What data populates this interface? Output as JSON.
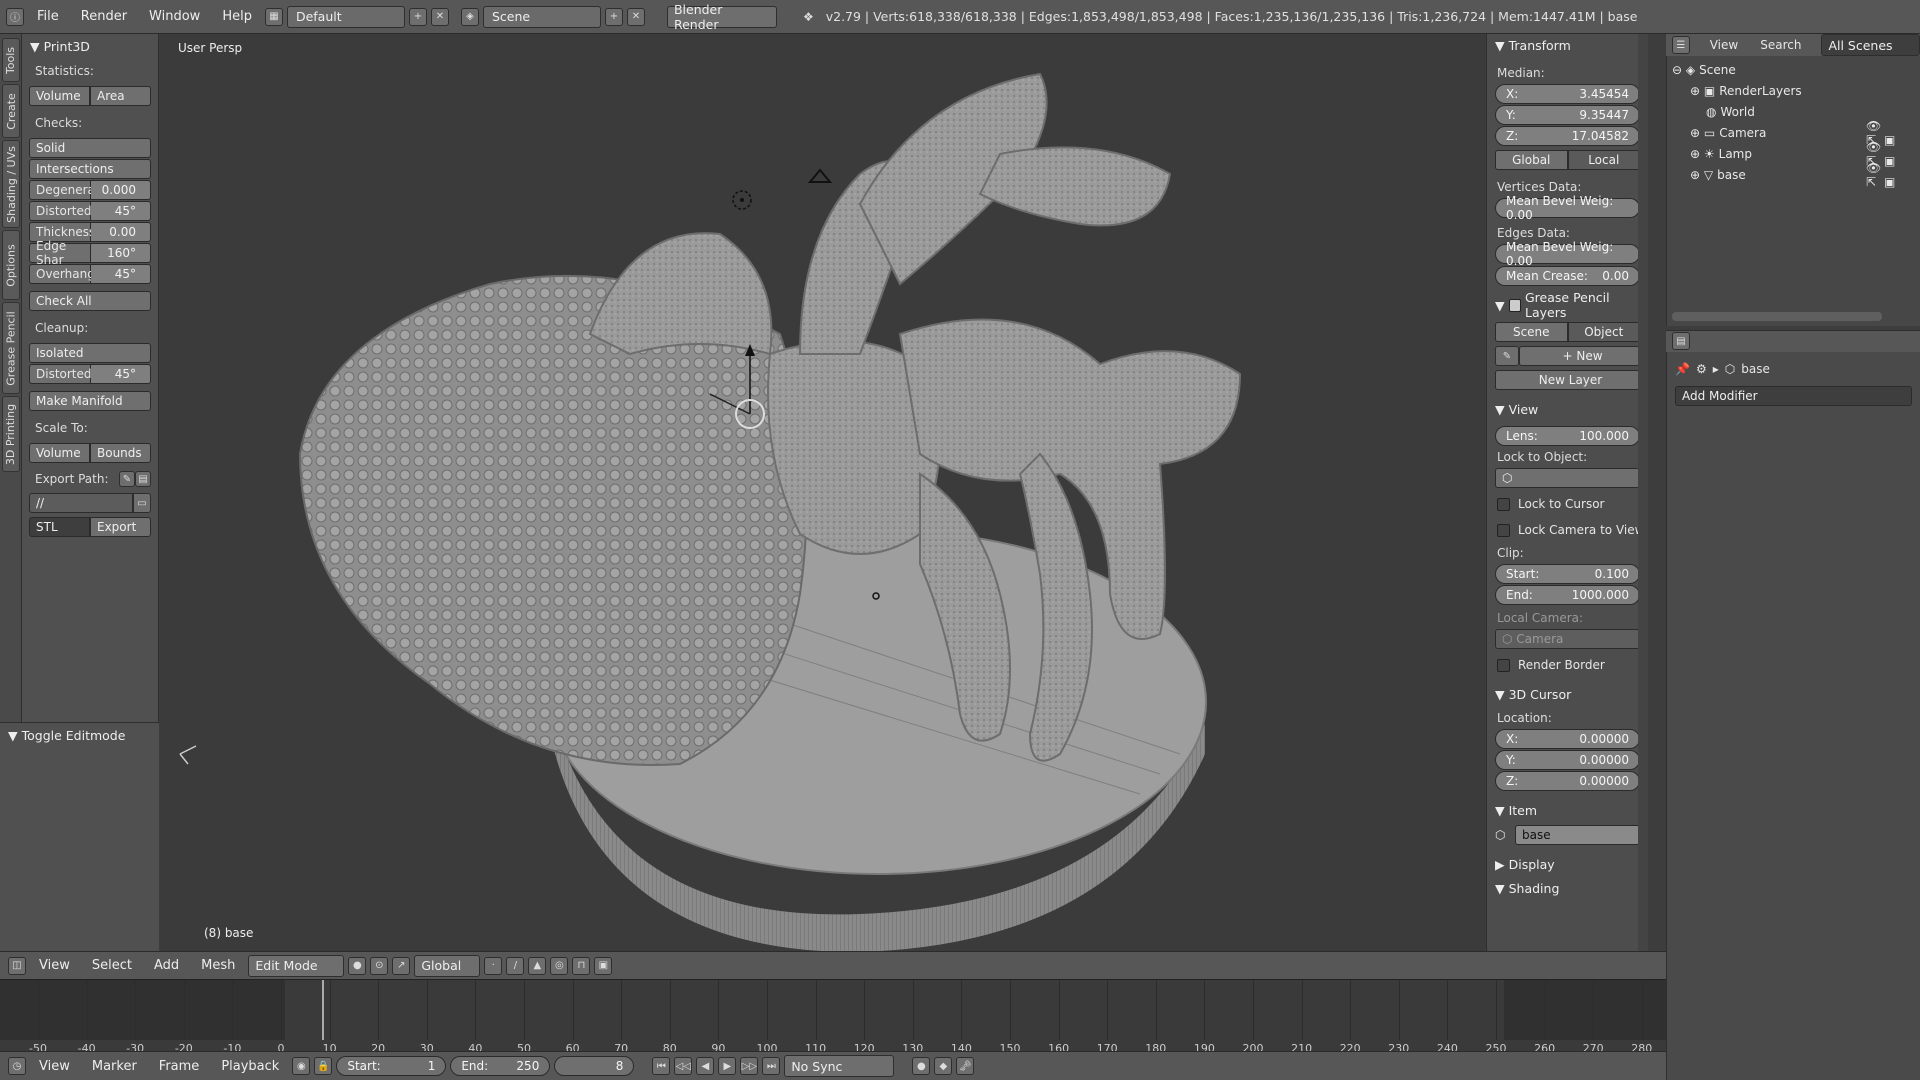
{
  "topbar": {
    "menus": [
      "File",
      "Render",
      "Window",
      "Help"
    ],
    "layout": "Default",
    "scene": "Scene",
    "engine": "Blender Render",
    "info": "v2.79 | Verts:618,338/618,338 | Edges:1,853,498/1,853,498 | Faces:1,235,136/1,235,136 | Tris:1,236,724 | Mem:1447.41M | base"
  },
  "toolstrip": {
    "tabs": [
      "Tools",
      "Create",
      "Shading / UVs",
      "Options",
      "Grease Pencil",
      "3D Printing"
    ]
  },
  "print3d": {
    "title": "Print3D",
    "statistics_label": "Statistics:",
    "stat_buttons": [
      "Volume",
      "Area"
    ],
    "checks_label": "Checks:",
    "solid": "Solid",
    "intersections": "Intersections",
    "props": [
      {
        "label": "Degenera",
        "value": "0.000"
      },
      {
        "label": "Distorted",
        "value": "45°"
      },
      {
        "label": "Thickness",
        "value": "0.00"
      },
      {
        "label": "Edge Shar",
        "value": "160°"
      },
      {
        "label": "Overhang",
        "value": "45°"
      }
    ],
    "check_all": "Check All",
    "cleanup_label": "Cleanup:",
    "isolated": "Isolated",
    "cleanup_distorted": {
      "label": "Distorted",
      "value": "45°"
    },
    "make_manifold": "Make Manifold",
    "scale_label": "Scale To:",
    "scale_buttons": [
      "Volume",
      "Bounds"
    ],
    "export_path_label": "Export Path:",
    "export_path": "//",
    "format": "STL",
    "export_button": "Export"
  },
  "toggle_editmode": "Toggle Editmode",
  "viewport": {
    "label": "User Persp",
    "object_label": "(8) base"
  },
  "properties": {
    "transform_title": "Transform",
    "median_label": "Median:",
    "median": [
      {
        "axis": "X:",
        "value": "3.45454"
      },
      {
        "axis": "Y:",
        "value": "9.35447"
      },
      {
        "axis": "Z:",
        "value": "17.04582"
      }
    ],
    "space_buttons": [
      "Global",
      "Local"
    ],
    "vertices_data": "Vertices Data:",
    "vert_bevel": "Mean Bevel Weig: 0.00",
    "edges_data": "Edges Data:",
    "edge_bevel": "Mean Bevel Weig: 0.00",
    "mean_crease": {
      "label": "Mean Crease:",
      "value": "0.00"
    },
    "grease_title": "Grease Pencil Layers",
    "grease_buttons": [
      "Scene",
      "Object"
    ],
    "new_label": "New",
    "new_layer": "New Layer",
    "view_title": "View",
    "lens": {
      "label": "Lens:",
      "value": "100.000"
    },
    "lock_object_label": "Lock to Object:",
    "lock_cursor": "Lock to Cursor",
    "lock_camera": "Lock Camera to View",
    "clip_label": "Clip:",
    "clip_start": {
      "label": "Start:",
      "value": "0.100"
    },
    "clip_end": {
      "label": "End:",
      "value": "1000.000"
    },
    "local_camera_label": "Local Camera:",
    "local_camera": "Camera",
    "render_border": "Render Border",
    "cursor_title": "3D Cursor",
    "location_label": "Location:",
    "cursor": [
      {
        "axis": "X:",
        "value": "0.00000"
      },
      {
        "axis": "Y:",
        "value": "0.00000"
      },
      {
        "axis": "Z:",
        "value": "0.00000"
      }
    ],
    "item_title": "Item",
    "item_name": "base",
    "display_title": "Display",
    "shading_title": "Shading"
  },
  "outliner": {
    "header": [
      "View",
      "Search"
    ],
    "scenes": "All Scenes",
    "items": [
      "Scene",
      "RenderLayers",
      "World",
      "Camera",
      "Lamp",
      "base"
    ]
  },
  "props_editor": {
    "object_name": "base",
    "add_modifier": "Add Modifier"
  },
  "viewport_header": {
    "menus": [
      "View",
      "Select",
      "Add",
      "Mesh"
    ],
    "mode": "Edit Mode",
    "orientation": "Global"
  },
  "timeline": {
    "ticks": [
      "-50",
      "-40",
      "-30",
      "-20",
      "-10",
      "0",
      "10",
      "20",
      "30",
      "40",
      "50",
      "60",
      "70",
      "80",
      "90",
      "100",
      "110",
      "120",
      "130",
      "140",
      "150",
      "160",
      "170",
      "180",
      "190",
      "200",
      "210",
      "220",
      "230",
      "240",
      "250",
      "260",
      "270",
      "280"
    ],
    "current_frame": 8
  },
  "timeline_header": {
    "menus": [
      "View",
      "Marker",
      "Frame",
      "Playback"
    ],
    "start": {
      "label": "Start:",
      "value": "1"
    },
    "end": {
      "label": "End:",
      "value": "250"
    },
    "frame": "8",
    "sync": "No Sync"
  }
}
